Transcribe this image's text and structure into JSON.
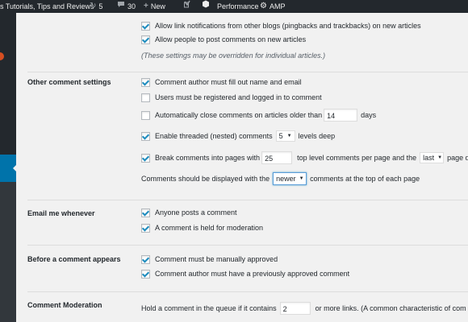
{
  "admin_bar": {
    "site_name": "s Tutorials, Tips and Reviews",
    "updates_count": "5",
    "comments_count": "30",
    "new_label": "New",
    "performance_label": "Performance",
    "amp_label": "AMP",
    "icons": {
      "updates": "refresh-icon",
      "comments": "comment-icon",
      "new": "plus-icon",
      "yoast": "yoast-icon",
      "performance": "performance-icon",
      "amp": "gear-icon"
    }
  },
  "colors": {
    "admin_bar_bg": "#23282d",
    "active_menu": "#0073aa",
    "checkbox_check": "#1e8cbe",
    "content_bg": "#f1f1f1"
  },
  "top_options": {
    "link_notifications": "Allow link notifications from other blogs (pingbacks and trackbacks) on new articles",
    "allow_comments": "Allow people to post comments on new articles",
    "override_note": "(These settings may be overridden for individual articles.)"
  },
  "other_comment_settings": {
    "label": "Other comment settings",
    "require_name_email": "Comment author must fill out name and email",
    "registration_required": "Users must be registered and logged in to comment",
    "close_comments_prefix": "Automatically close comments on articles older than",
    "close_comments_days": "14",
    "close_comments_suffix": "days",
    "threaded_prefix": "Enable threaded (nested) comments",
    "threaded_depth": "5",
    "threaded_suffix": "levels deep",
    "paged_prefix": "Break comments into pages with",
    "paged_count": "25",
    "paged_middle": "top level comments per page and the",
    "paged_page": "last",
    "paged_suffix": "page di",
    "order_prefix": "Comments should be displayed with the",
    "order_value": "newer",
    "order_suffix": "comments at the top of each page"
  },
  "email_me": {
    "label": "Email me whenever",
    "anyone_posts": "Anyone posts a comment",
    "held_for_moderation": "A comment is held for moderation"
  },
  "before_appears": {
    "label": "Before a comment appears",
    "manually_approved": "Comment must be manually approved",
    "previously_approved": "Comment author must have a previously approved comment"
  },
  "moderation": {
    "label": "Comment Moderation",
    "hold_prefix": "Hold a comment in the queue if it contains",
    "links_count": "2",
    "hold_suffix": "or more links. (A common characteristic of com"
  }
}
